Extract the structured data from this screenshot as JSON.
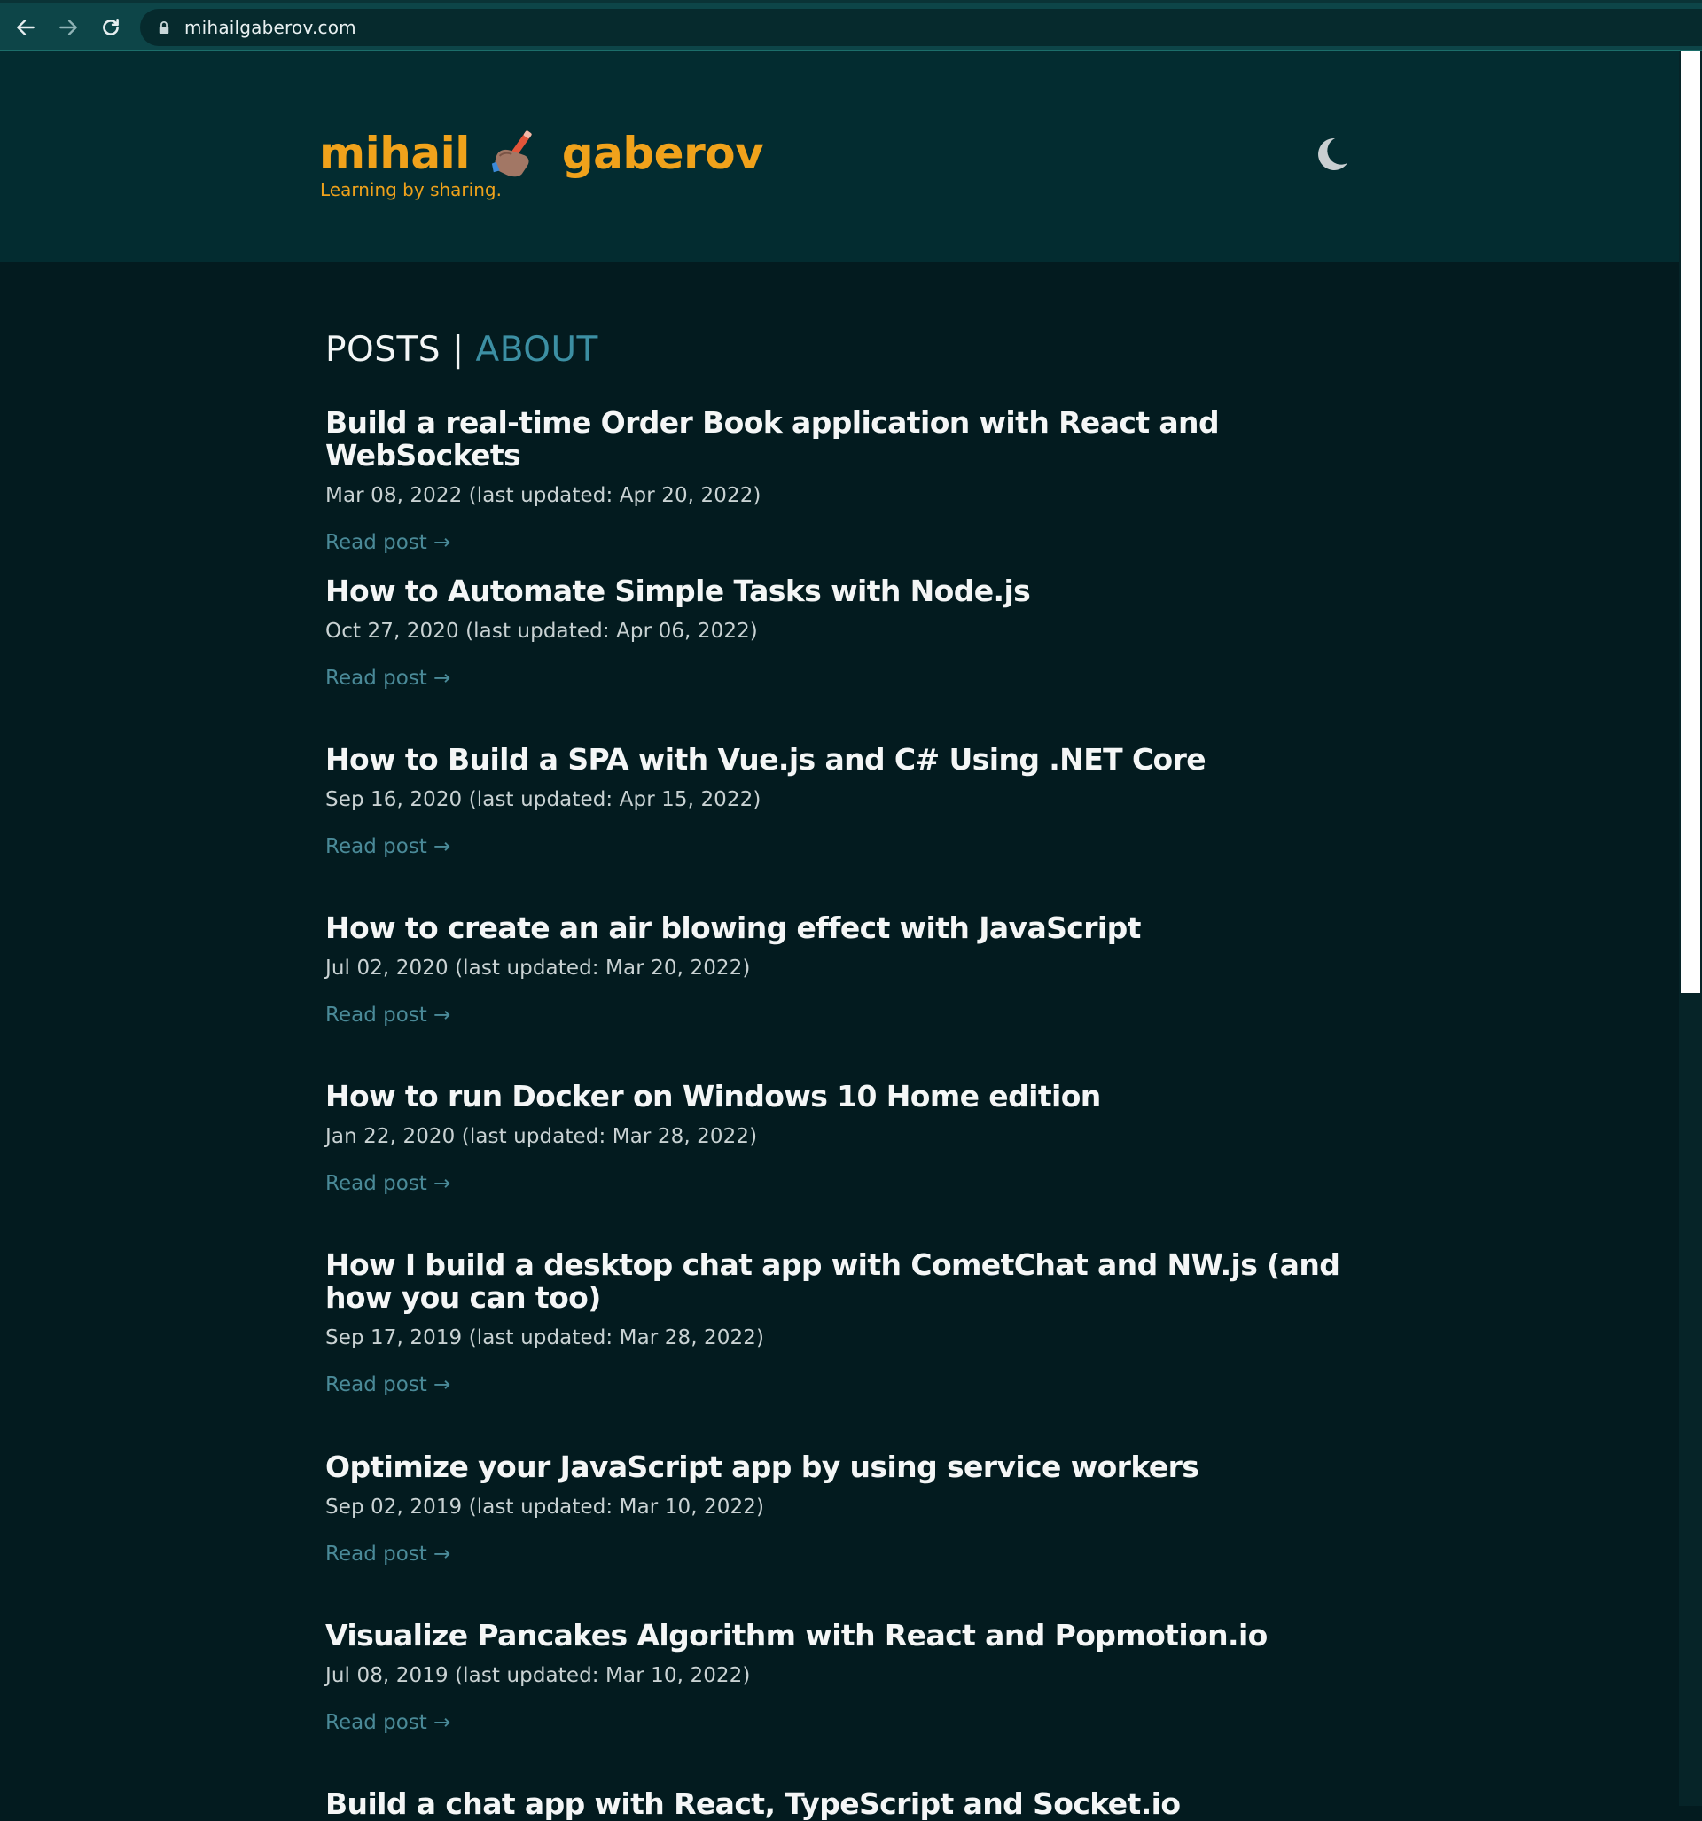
{
  "browser": {
    "url": "mihailgaberov.com"
  },
  "site": {
    "name_first": "mihail",
    "name_last": "gaberov",
    "tagline": "Learning by sharing."
  },
  "nav": {
    "posts": "POSTS",
    "separator": "|",
    "about": "ABOUT"
  },
  "posts": [
    {
      "title": "Build a real-time Order Book application with React and WebSockets",
      "date": "Mar 08, 2022 (last updated: Apr 20, 2022)",
      "link": "Read post →"
    },
    {
      "title": "How to Automate Simple Tasks with Node.js",
      "date": "Oct 27, 2020 (last updated: Apr 06, 2022)",
      "link": "Read post →"
    },
    {
      "title": "How to Build a SPA with Vue.js and C# Using .NET Core",
      "date": "Sep 16, 2020 (last updated: Apr 15, 2022)",
      "link": "Read post →"
    },
    {
      "title": "How to create an air blowing effect with JavaScript",
      "date": "Jul 02, 2020 (last updated: Mar 20, 2022)",
      "link": "Read post →"
    },
    {
      "title": "How to run Docker on Windows 10 Home edition",
      "date": "Jan 22, 2020 (last updated: Mar 28, 2022)",
      "link": "Read post →"
    },
    {
      "title": "How I build a desktop chat app with CometChat and NW.js (and how you can too)",
      "date": "Sep 17, 2019 (last updated: Mar 28, 2022)",
      "link": "Read post →"
    },
    {
      "title": "Optimize your JavaScript app by using service workers",
      "date": "Sep 02, 2019 (last updated: Mar 10, 2022)",
      "link": "Read post →"
    },
    {
      "title": "Visualize Pancakes Algorithm with React and Popmotion.io",
      "date": "Jul 08, 2019 (last updated: Mar 10, 2022)",
      "link": "Read post →"
    },
    {
      "title": "Build a chat app with React, TypeScript and Socket.io",
      "date": "",
      "link": ""
    }
  ],
  "colors": {
    "accent": "#f0a21b",
    "link": "#4a8a98",
    "background": "#031b1f",
    "header": "#032c30"
  }
}
